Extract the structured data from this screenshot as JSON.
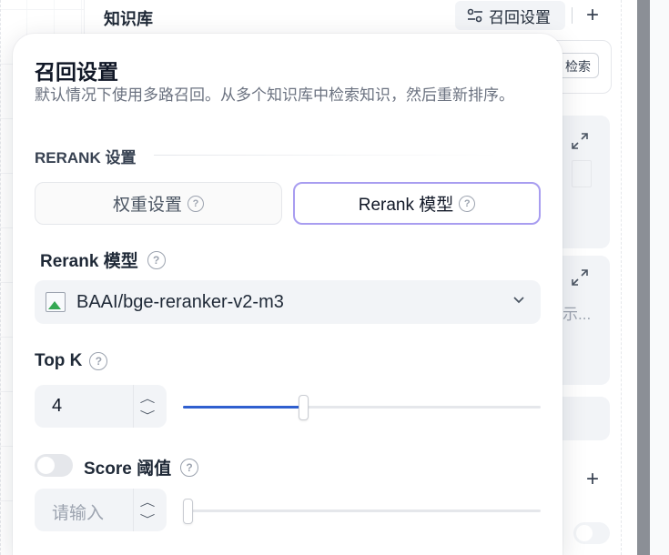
{
  "background": {
    "kb_title": "知识库",
    "recall_button_label": "召回设置",
    "search_button_label": "检索",
    "truncated_text": "示...",
    "plus_icon": "plus-icon",
    "expand_icon": "expand-icon"
  },
  "popover": {
    "title": "召回设置",
    "description": "默认情况下使用多路召回。从多个知识库中检索知识，然后重新排序。",
    "section_title": "RERANK 设置",
    "tabs": [
      {
        "label": "权重设置",
        "selected": false
      },
      {
        "label": "Rerank 模型",
        "selected": true
      }
    ],
    "rerank_model": {
      "label": "Rerank 模型",
      "value": "BAAI/bge-reranker-v2-m3"
    },
    "top_k": {
      "label": "Top K",
      "value": "4",
      "slider_fraction": 0.337
    },
    "score_threshold": {
      "label": "Score 阈值",
      "enabled": false,
      "placeholder": "请输入",
      "slider_fraction": 0.0
    },
    "help_glyph": "?",
    "accent_color": "#2f5fcf",
    "selected_tab_border": "#a89df0"
  }
}
